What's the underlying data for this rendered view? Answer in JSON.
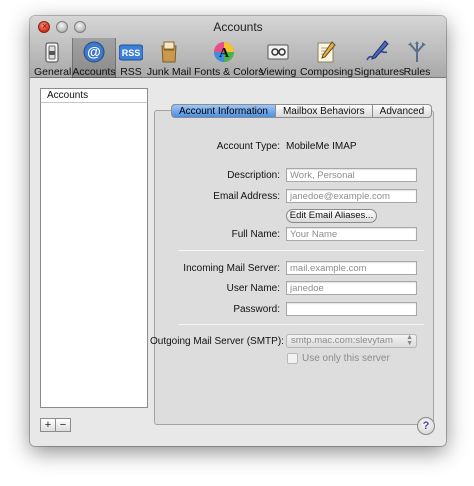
{
  "window": {
    "title": "Accounts",
    "close_glyph": "×"
  },
  "toolbar": {
    "items": [
      {
        "label": "General",
        "icon": "general-switch-icon"
      },
      {
        "label": "Accounts",
        "icon": "at-sign-icon",
        "selected": true
      },
      {
        "label": "RSS",
        "icon": "rss-icon"
      },
      {
        "label": "Junk Mail",
        "icon": "junk-mail-icon"
      },
      {
        "label": "Fonts & Colors",
        "icon": "fonts-colors-icon"
      },
      {
        "label": "Viewing",
        "icon": "viewing-icon"
      },
      {
        "label": "Composing",
        "icon": "composing-icon"
      },
      {
        "label": "Signatures",
        "icon": "signatures-icon"
      },
      {
        "label": "Rules",
        "icon": "rules-icon"
      }
    ],
    "at_glyph": "@",
    "rss_text": "RSS"
  },
  "accounts_list": {
    "header": "Accounts"
  },
  "list_buttons": {
    "add": "+",
    "remove": "−"
  },
  "tabs": [
    "Account Information",
    "Mailbox Behaviors",
    "Advanced"
  ],
  "form": {
    "account_type_label": "Account Type:",
    "account_type_value": "MobileMe IMAP",
    "description_label": "Description:",
    "description_placeholder": "Work, Personal",
    "email_label": "Email Address:",
    "email_placeholder": "janedoe@example.com",
    "edit_aliases_button": "Edit Email Aliases...",
    "full_name_label": "Full Name:",
    "full_name_placeholder": "Your Name",
    "incoming_server_label": "Incoming Mail Server:",
    "incoming_server_placeholder": "mail.example.com",
    "user_name_label": "User Name:",
    "user_name_placeholder": "janedoe",
    "password_label": "Password:",
    "password_value": "",
    "smtp_label": "Outgoing Mail Server (SMTP):",
    "smtp_value": "smtp.mac.com:slevytam",
    "use_only_label": "Use only this server"
  },
  "help_glyph": "?",
  "colors": {
    "active_tab": "#4d8fe0",
    "toolbar_top": "#d6d6d6",
    "toolbar_bottom": "#a9a9a9",
    "close_button": "#d8311f",
    "help_question": "#5b3fa6"
  }
}
